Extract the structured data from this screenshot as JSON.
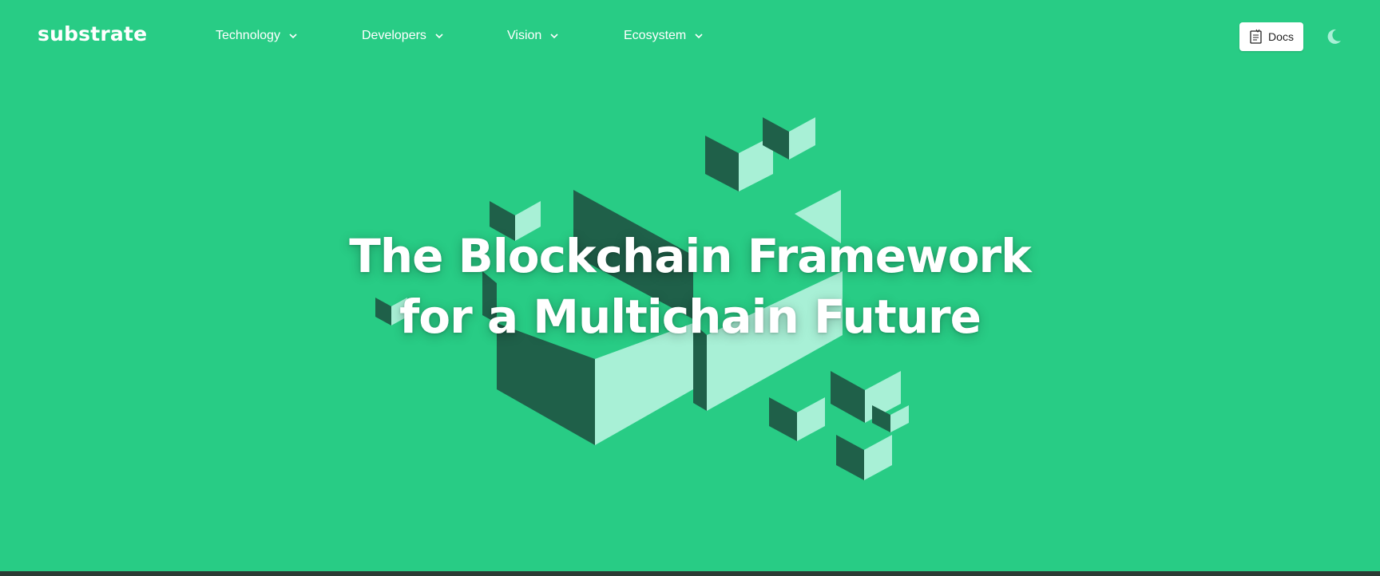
{
  "header": {
    "logo": "substrate",
    "nav": [
      {
        "label": "Technology"
      },
      {
        "label": "Developers"
      },
      {
        "label": "Vision"
      },
      {
        "label": "Ecosystem"
      }
    ],
    "docs_label": "Docs"
  },
  "hero": {
    "title_line1": "The Blockchain Framework",
    "title_line2": "for a Multichain Future"
  },
  "colors": {
    "background": "#28cc85",
    "cube_dark": "#1f6049",
    "cube_light": "#a8f0d6"
  },
  "icons": [
    "chevron-down-icon",
    "docs-icon",
    "moon-icon"
  ]
}
